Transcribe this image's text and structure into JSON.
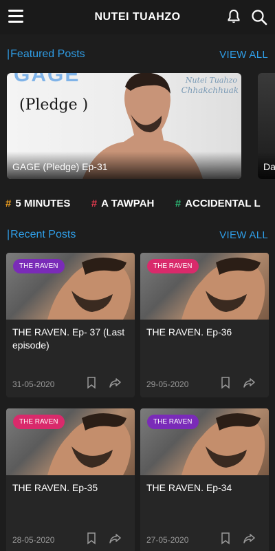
{
  "header": {
    "title": "Nutei Tuahzo"
  },
  "icons": {
    "menu": "menu-icon",
    "bell": "bell-icon",
    "search": "search-icon"
  },
  "featured": {
    "heading": "Featured Posts",
    "view_all": "VIEW ALL",
    "cards": [
      {
        "caption": "GAGE (Pledge) Ep-31",
        "image_text_top": "GAGE",
        "image_text_main": "(Pledge )",
        "watermark_1": "Nutei Tuahzo",
        "watermark_2": "Chhakchhuak"
      },
      {
        "caption": "Da"
      }
    ]
  },
  "tags": [
    {
      "hash": "#",
      "label": "5 MINUTES",
      "color": "#f0a020"
    },
    {
      "hash": "#",
      "label": "A TAWPAH",
      "color": "#e23b4e"
    },
    {
      "hash": "#",
      "label": "ACCIDENTAL L",
      "color": "#2bb673"
    }
  ],
  "recent": {
    "heading": "Recent Posts",
    "view_all": "VIEW ALL",
    "posts": [
      {
        "badge": "THE RAVEN",
        "badge_color": "purple",
        "title": "THE RAVEN. Ep- 37 (Last episode)",
        "date": "31-05-2020"
      },
      {
        "badge": "THE RAVEN",
        "badge_color": "pink",
        "title": "THE RAVEN. Ep-36",
        "date": "29-05-2020"
      },
      {
        "badge": "THE RAVEN",
        "badge_color": "pink",
        "title": "THE RAVEN. Ep-35",
        "date": "28-05-2020"
      },
      {
        "badge": "THE RAVEN",
        "badge_color": "purple",
        "title": "THE RAVEN. Ep-34",
        "date": "27-05-2020"
      }
    ]
  },
  "colors": {
    "accent": "#2f9de6",
    "background": "#1d1d1d",
    "card": "#262626"
  }
}
